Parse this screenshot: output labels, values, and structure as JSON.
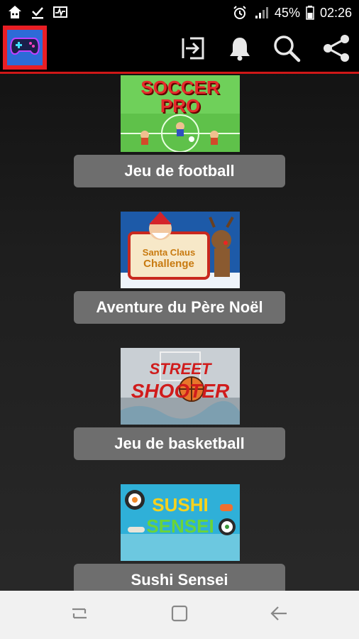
{
  "status_bar": {
    "battery_percent": "45%",
    "time": "02:26",
    "left_icons": [
      "home-app-icon",
      "download-check-icon",
      "activity-icon"
    ],
    "right_icons": [
      "alarm-icon",
      "signal-icon",
      "battery-icon"
    ]
  },
  "toolbar": {
    "app_icon": "gamepad-icon",
    "actions": [
      "login-icon",
      "bell-icon",
      "search-icon",
      "share-icon"
    ]
  },
  "games": [
    {
      "label": "Jeu de football",
      "thumb_text": [
        "SOCCER",
        "PRO"
      ]
    },
    {
      "label": "Aventure du Père Noël",
      "thumb_text": [
        "Santa Claus",
        "Challenge"
      ]
    },
    {
      "label": "Jeu de basketball",
      "thumb_text": [
        "STREET",
        "SHOOTER"
      ]
    },
    {
      "label": "Sushi Sensei",
      "thumb_text": [
        "SUSHI",
        "SENSEI"
      ]
    }
  ],
  "nav_bar": {
    "buttons": [
      "recent-apps-icon",
      "home-icon",
      "back-icon"
    ]
  },
  "colors": {
    "accent": "#d01818",
    "label_bg": "#6e6e6e",
    "app_icon_bg": "#2d6bd7"
  }
}
